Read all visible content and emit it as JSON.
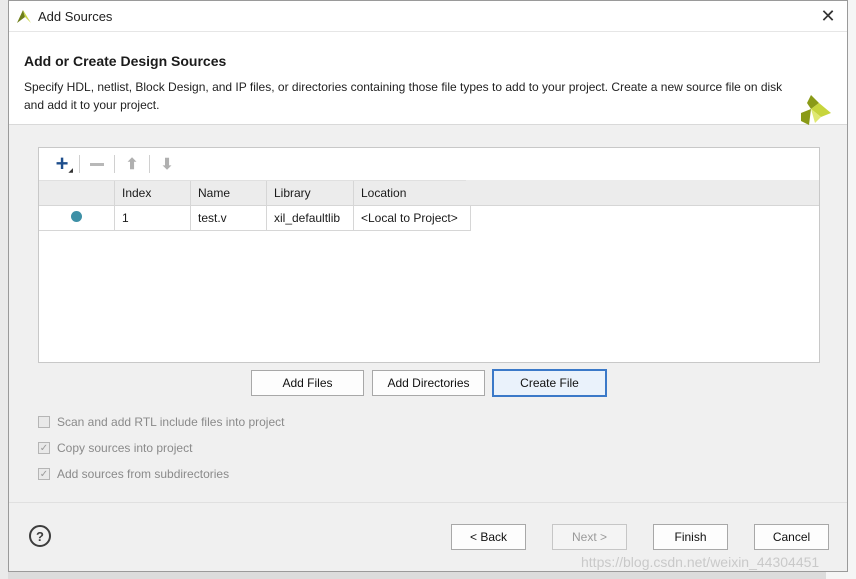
{
  "window": {
    "title": "Add Sources",
    "close_glyph": "✕"
  },
  "header": {
    "title": "Add or Create Design Sources",
    "description": "Specify HDL, netlist, Block Design, and IP files, or directories containing those file types to add to your project. Create a new source file on disk and add it to your project."
  },
  "toolbar": {
    "icons": [
      "add-icon",
      "remove-icon",
      "move-up-icon",
      "move-down-icon"
    ]
  },
  "table": {
    "columns": [
      "",
      "Index",
      "Name",
      "Library",
      "Location"
    ],
    "rows": [
      {
        "status": "",
        "index": "1",
        "name": "test.v",
        "library": "xil_defaultlib",
        "location": "<Local to Project>"
      }
    ]
  },
  "actions": {
    "add_files": "Add Files",
    "add_directories": "Add Directories",
    "create_file": "Create File"
  },
  "options": {
    "scan_rtl": {
      "label": "Scan and add RTL include files into project",
      "checked": false
    },
    "copy_sources": {
      "label": "Copy sources into project",
      "checked": true
    },
    "add_subdirs": {
      "label": "Add sources from subdirectories",
      "checked": true
    }
  },
  "footer": {
    "help": "?",
    "back": "< Back",
    "next": "Next >",
    "finish": "Finish",
    "cancel": "Cancel"
  },
  "watermark": "https://blog.csdn.net/weixin_44304451",
  "colors": {
    "accent": "#3b79c8",
    "status_dot": "#3e90a6",
    "brand": "#b4c52a"
  }
}
